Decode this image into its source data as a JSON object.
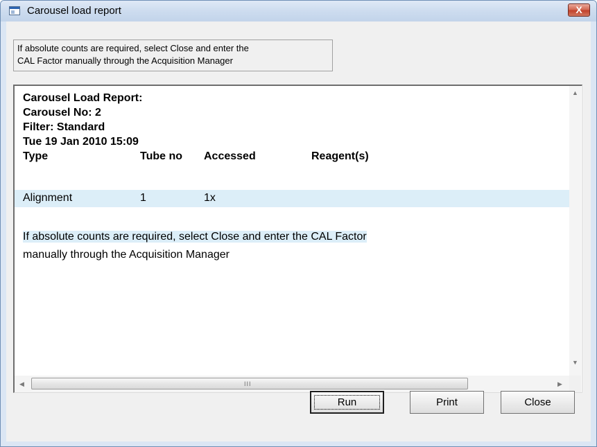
{
  "window": {
    "title": "Carousel load report",
    "close_glyph": "X"
  },
  "info_box": {
    "line1": "If absolute counts are required, select Close and enter the",
    "line2": "CAL Factor manually through the Acquisition Manager"
  },
  "report": {
    "heading": "Carousel Load Report:",
    "carousel_no": "Carousel No: 2",
    "filter": "Filter: Standard",
    "timestamp": "Tue 19 Jan 2010 15:09",
    "columns": [
      "Type",
      "Tube no",
      "Accessed",
      "Reagent(s)"
    ],
    "rows": [
      {
        "type": "Alignment",
        "tube_no": "1",
        "accessed": "1x",
        "reagents": ""
      }
    ],
    "message_line1": "If absolute counts are required, select Close and enter the CAL Factor",
    "message_line2": "manually through the Acquisition Manager"
  },
  "scrollbars": {
    "up_arrow": "▲",
    "down_arrow": "▼",
    "left_arrow": "◀",
    "right_arrow": "▶",
    "thumb_grip": "III"
  },
  "buttons": {
    "run": "Run",
    "print": "Print",
    "close": "Close"
  },
  "colors": {
    "title_bar": "#cddcef",
    "close_button": "#c1412b",
    "highlight": "#dceef8"
  },
  "icons": {
    "window_icon": "window-app-icon",
    "close": "close-x-icon"
  }
}
